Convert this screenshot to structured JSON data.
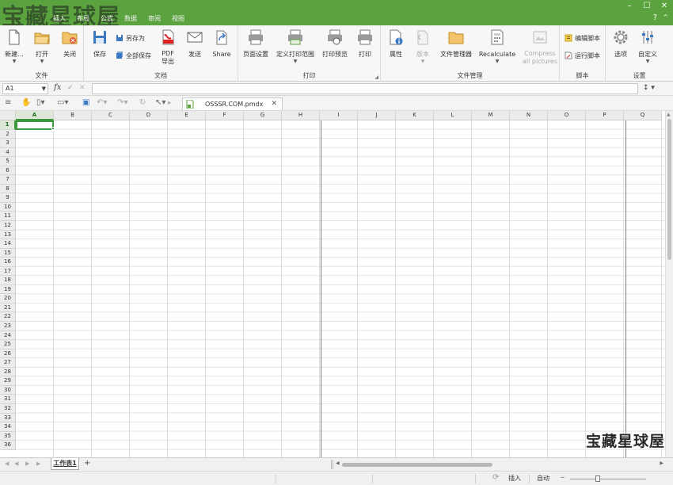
{
  "logo_text": "宝藏星球屋",
  "watermark_text": "宝藏星球屋",
  "colors": {
    "titlebar": "#5aa33f",
    "accent": "#3c9a3c"
  },
  "tabs": [
    {
      "label": "插入",
      "active": false
    },
    {
      "label": "布局",
      "active": false
    },
    {
      "label": "公式",
      "active": false
    },
    {
      "label": "数据",
      "active": false
    },
    {
      "label": "审阅",
      "active": false
    },
    {
      "label": "视图",
      "active": false
    }
  ],
  "window": {
    "minimize": "–",
    "maximize": "☐",
    "close": "✕",
    "help": "?",
    "collapse": "^"
  },
  "ribbon": {
    "file_group": "文件",
    "new": "新建...",
    "open": "打开",
    "close": "关闭",
    "doc_group": "文档",
    "save": "保存",
    "save_as": "另存为",
    "save_all": "全部保存",
    "pdf_export": "PDF\n导出",
    "send": "发送",
    "share": "Share",
    "print_group": "打印",
    "page_setup": "页面设置",
    "print_range": "定义打印范围",
    "print_preview": "打印预览",
    "print": "打印",
    "filemgr_group": "文件管理",
    "properties": "属性",
    "version": "版本",
    "file_manager": "文件管理器",
    "recalculate": "Recalculate",
    "compress": "Compress\nall pictures",
    "script_group": "脚本",
    "edit_script": "编辑脚本",
    "run_script": "运行脚本",
    "settings_group": "设置",
    "options": "选项",
    "customize": "自定义"
  },
  "formula_bar": {
    "cell_ref": "A1",
    "fx": "fx",
    "value": ""
  },
  "document_tab": {
    "name": "OSSSR.COM.pmdx"
  },
  "columns": [
    "A",
    "B",
    "C",
    "D",
    "E",
    "F",
    "G",
    "H",
    "I",
    "J",
    "K",
    "L",
    "M",
    "N",
    "O",
    "P",
    "Q"
  ],
  "rows": [
    "1",
    "2",
    "3",
    "4",
    "5",
    "6",
    "7",
    "8",
    "9",
    "10",
    "11",
    "12",
    "13",
    "14",
    "15",
    "16",
    "17",
    "18",
    "19",
    "20",
    "21",
    "22",
    "23",
    "24",
    "25",
    "26",
    "27",
    "28",
    "29",
    "30",
    "31",
    "32",
    "33",
    "34",
    "35",
    "36"
  ],
  "selected_cell": {
    "col": "A",
    "row": "1"
  },
  "sheets": [
    {
      "label": "工作表1",
      "active": true
    }
  ],
  "add_sheet": "+",
  "status": {
    "insert_mode": "插入",
    "calc_mode": "自动"
  }
}
